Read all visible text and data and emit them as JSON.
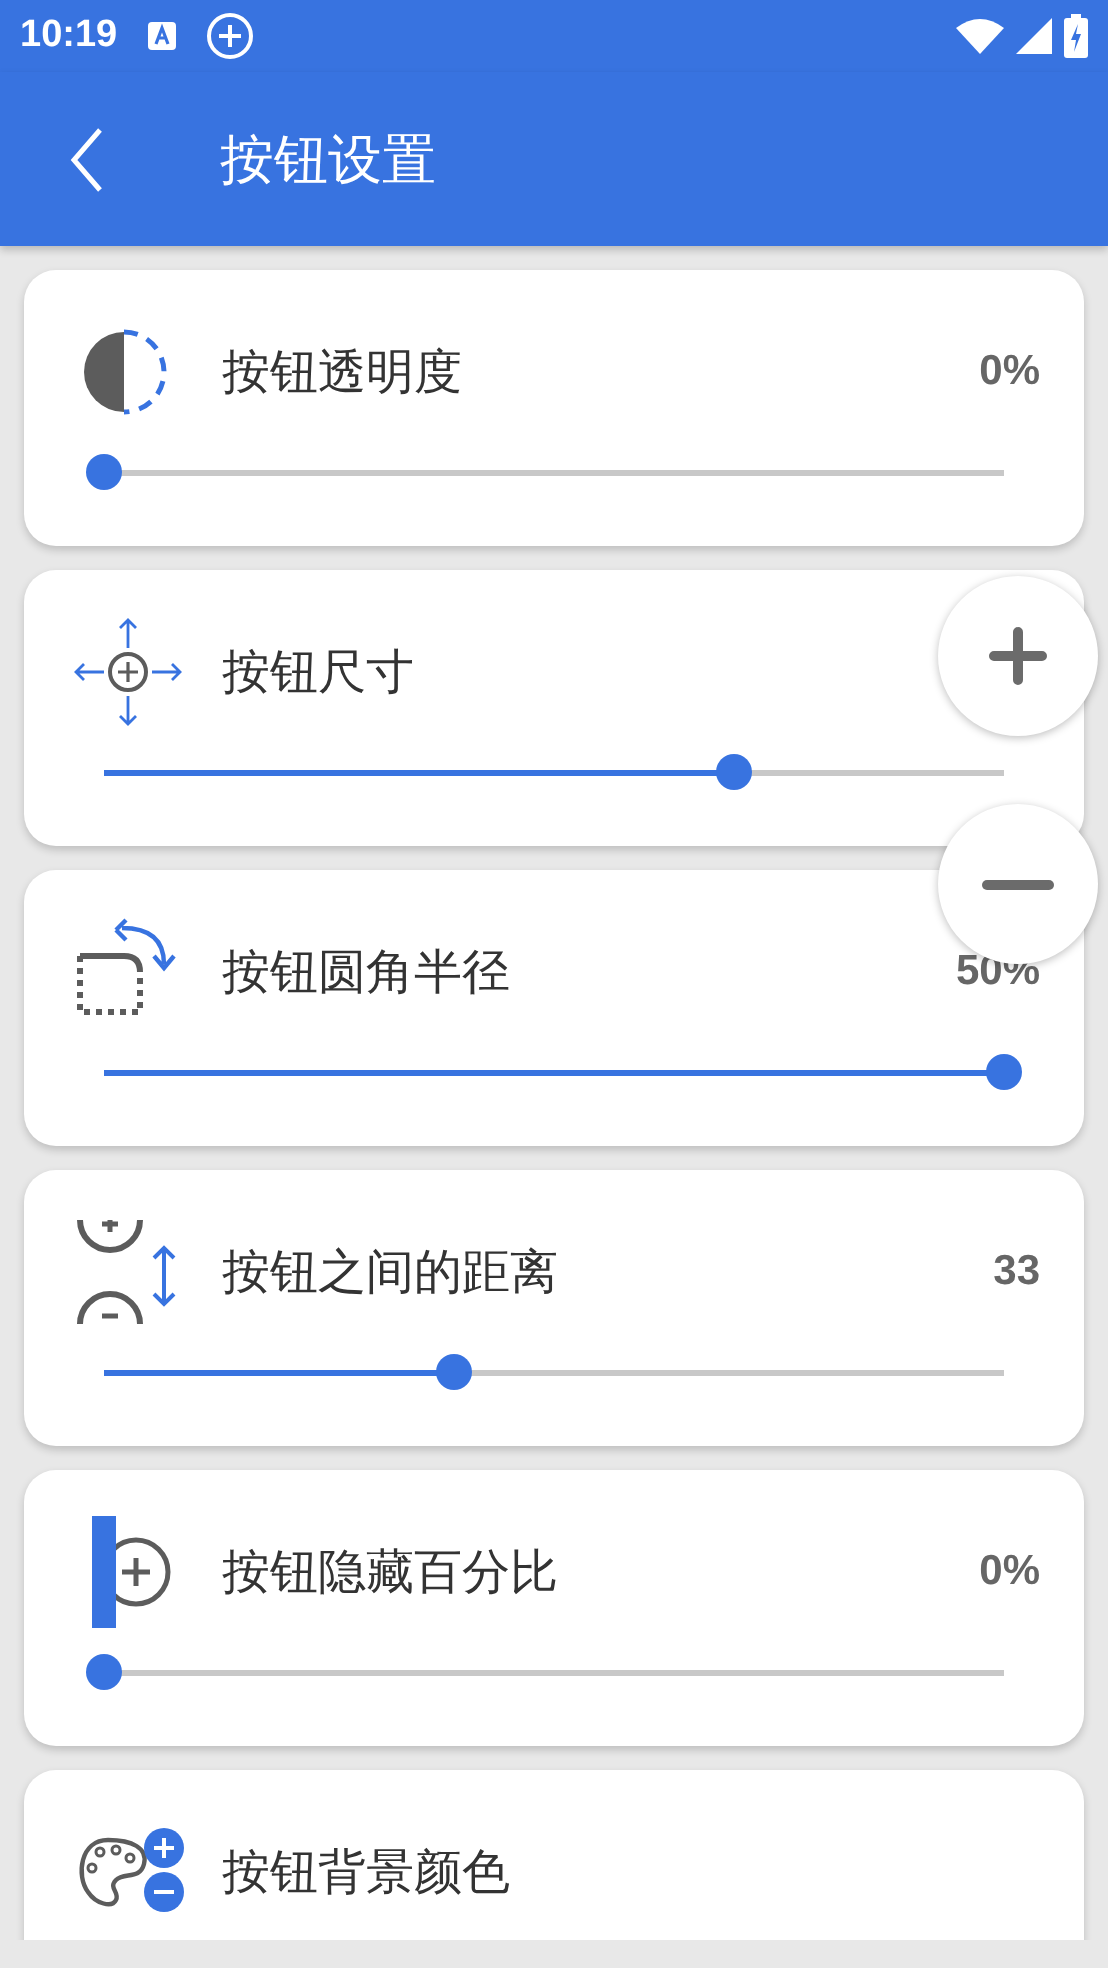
{
  "status_bar": {
    "time": "10:19"
  },
  "app_bar": {
    "title": "按钮设置"
  },
  "settings": [
    {
      "kind": "slider",
      "title": "按钮透明度",
      "value": "0%",
      "level": 0
    },
    {
      "kind": "slider",
      "title": "按钮尺寸",
      "level": 0.7
    },
    {
      "kind": "slider",
      "title": "按钮圆角半径",
      "value": "50%",
      "level": 1
    },
    {
      "kind": "slider",
      "title": "按钮之间的距离",
      "value": "33",
      "level": 0.389
    },
    {
      "kind": "slider",
      "title": "按钮隐藏百分比",
      "value": "0%",
      "level": 0
    },
    {
      "kind": "option",
      "title": "按钮背景颜色"
    }
  ],
  "floating_buttons": [
    {
      "kind": "plus"
    },
    {
      "kind": "minus"
    }
  ]
}
